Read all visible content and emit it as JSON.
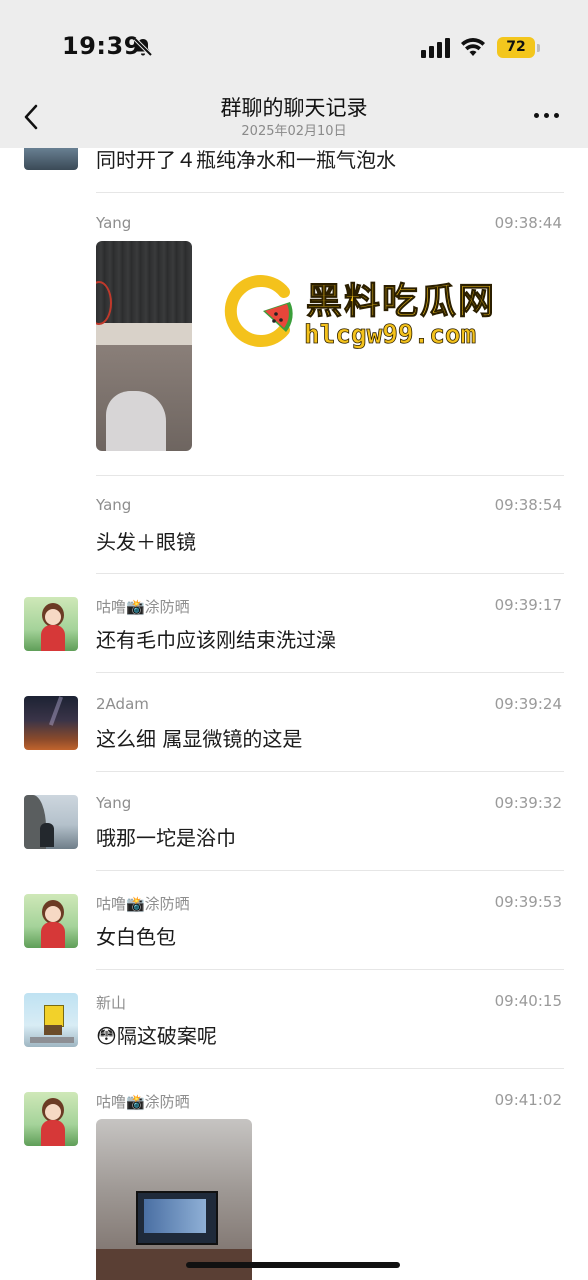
{
  "status_bar": {
    "time": "19:39",
    "battery": "72"
  },
  "nav": {
    "title": "群聊的聊天记录",
    "subtitle": "2025年02月10日"
  },
  "messages": [
    {
      "text": "同时开了４瓶纯净水和一瓶气泡水"
    },
    {
      "name": "Yang",
      "time": "09:38:44"
    },
    {
      "name": "Yang",
      "time": "09:38:54",
      "text": "头发＋眼镜"
    },
    {
      "name": "咕噜📸涂防晒",
      "time": "09:39:17",
      "text": "还有毛巾应该刚结束洗过澡"
    },
    {
      "name": "2Adam",
      "time": "09:39:24",
      "text": "这么细 属显微镜的这是"
    },
    {
      "name": "Yang",
      "time": "09:39:32",
      "text": "哦那一坨是浴巾"
    },
    {
      "name": "咕噜📸涂防晒",
      "time": "09:39:53",
      "text": "女白色包"
    },
    {
      "name": "新山",
      "time": "09:40:15",
      "text": "😳隔这破案呢"
    },
    {
      "name": "咕噜📸涂防晒",
      "time": "09:41:02"
    }
  ],
  "watermark": {
    "title": "黑料吃瓜网",
    "url": "hlcgw99.com"
  },
  "icons": [
    "bell-slash-icon",
    "signal-icon",
    "wifi-icon",
    "back-chevron-icon",
    "more-icon",
    "watermark-logo-icon"
  ]
}
